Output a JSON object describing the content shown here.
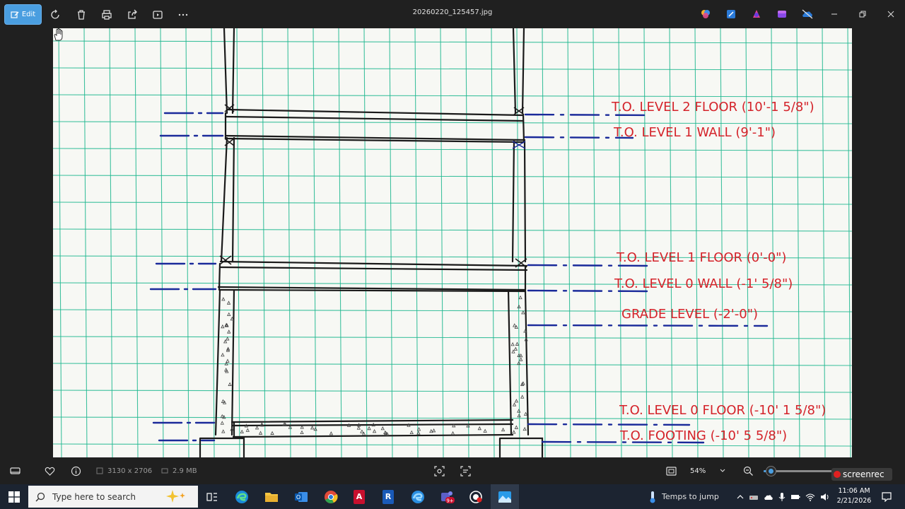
{
  "app": {
    "edit_label": "Edit",
    "file_title": "20260220_125457.jpg"
  },
  "drawing": {
    "notes": [
      {
        "id": "note-level2-floor",
        "text": "T.O. LEVEL 2 FLOOR (10'-1 5/8\")"
      },
      {
        "id": "note-level1-wall",
        "text": "T.O. LEVEL 1 WALL (9'-1\")"
      },
      {
        "id": "note-level1-floor",
        "text": "T.O. LEVEL 1 FLOOR (0'-0\")"
      },
      {
        "id": "note-level0-wall",
        "text": "T.O. LEVEL 0 WALL (-1' 5/8\")"
      },
      {
        "id": "note-grade-level",
        "text": "GRADE LEVEL (-2'-0\")"
      },
      {
        "id": "note-level0-floor",
        "text": "T.O. LEVEL 0 FLOOR (-10' 1 5/8\")"
      },
      {
        "id": "note-footing",
        "text": "T.O. FOOTING (-10' 5 5/8\")"
      }
    ]
  },
  "status": {
    "dimensions": "3130 x 2706",
    "file_size": "2.9 MB",
    "zoom": "54%",
    "zoom_fraction": 0.1,
    "recorder": "screenrec"
  },
  "taskbar": {
    "search_placeholder": "Type here to search",
    "weather": "Temps to jump",
    "time": "11:06 AM",
    "date": "2/21/2026",
    "badge": "9+"
  },
  "colors": {
    "grid": "#1fb890",
    "ink": "#1a1a1a",
    "blue_ink": "#1a2a9a",
    "red_ink": "#d4232a",
    "accent": "#4a9ee0"
  }
}
